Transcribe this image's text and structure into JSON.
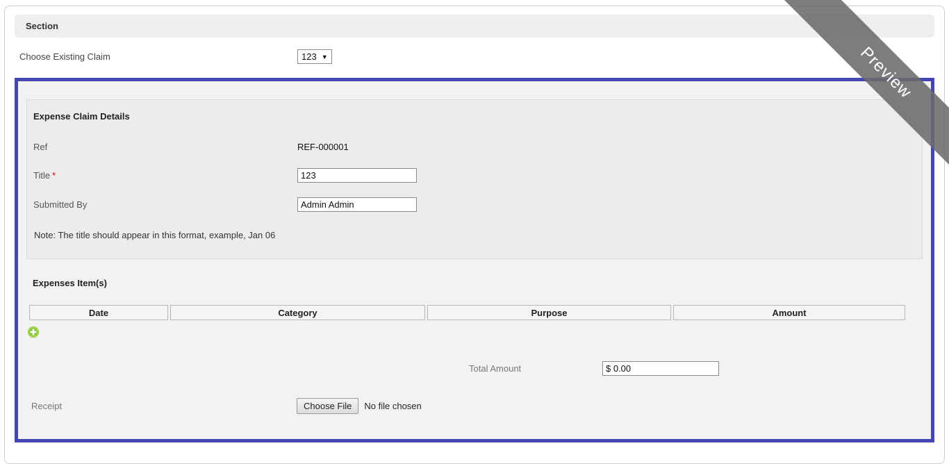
{
  "section": {
    "title": "Section"
  },
  "choose_claim": {
    "label": "Choose Existing Claim",
    "selected_value": "123",
    "dropdown_arrow_glyph": "▼"
  },
  "claim_details": {
    "title": "Expense Claim Details",
    "fields": {
      "ref": {
        "label": "Ref",
        "value": "REF-000001"
      },
      "title": {
        "label": "Title",
        "required_mark": "*",
        "value": "123"
      },
      "submitted_by": {
        "label": "Submitted By",
        "value": "Admin Admin"
      }
    },
    "note": "Note: The title should appear in this format, example, Jan 06"
  },
  "expenses": {
    "title": "Expenses Item(s)",
    "columns": [
      "Date",
      "Category",
      "Purpose",
      "Amount"
    ],
    "rows": [],
    "total": {
      "label": "Total Amount",
      "value": "$ 0.00"
    }
  },
  "receipt": {
    "label": "Receipt",
    "button_label": "Choose File",
    "status_text": "No file chosen"
  },
  "ribbon": {
    "text": "Preview"
  },
  "colors": {
    "accent_border": "#4545b4",
    "ribbon_gray": "#6b6b6b",
    "add_icon_green": "#8cc63e",
    "required_red": "#cc0000",
    "section_bar_bg": "#eeeeee"
  }
}
